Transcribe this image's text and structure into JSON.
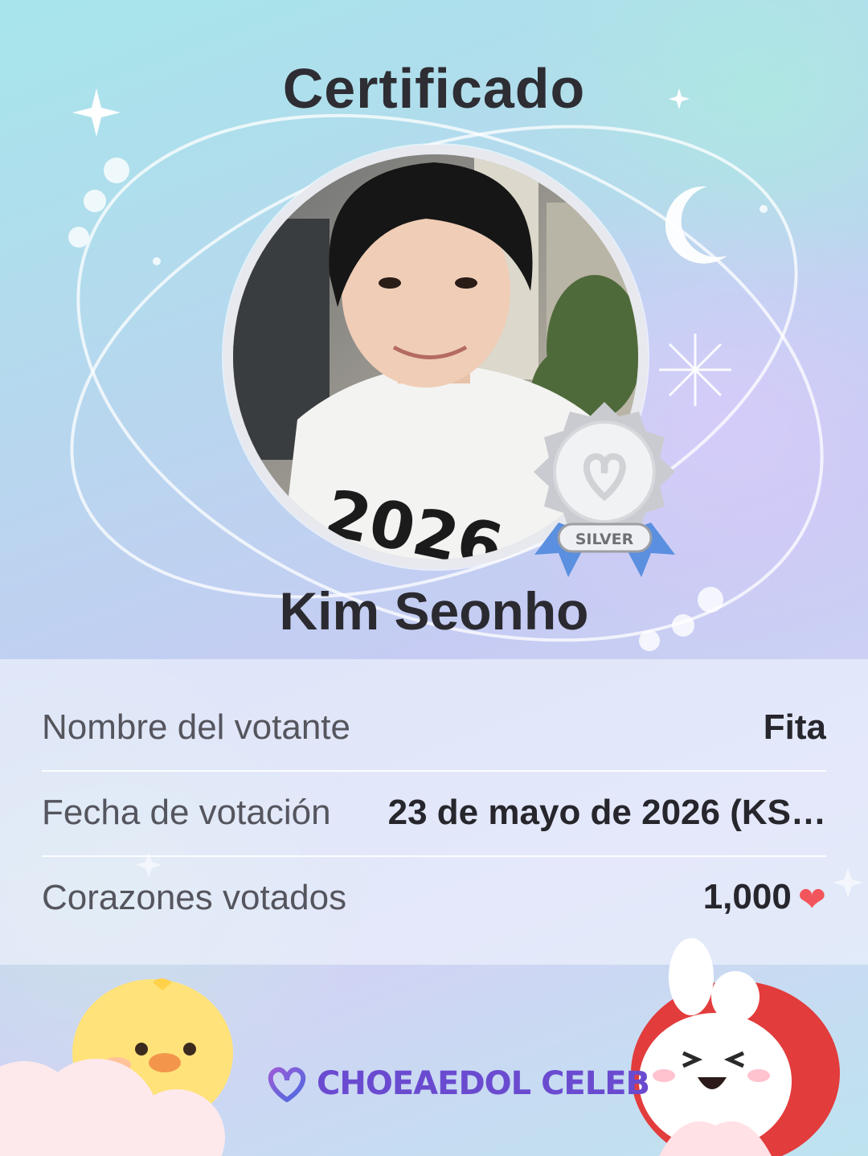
{
  "header": {
    "title": "Certificado"
  },
  "celebrity": {
    "name": "Kim Seonho"
  },
  "badge": {
    "tier": "SILVER",
    "icon": "silver-medal-icon"
  },
  "details": {
    "voter_label": "Nombre del votante",
    "voter_value": "Fita",
    "date_label": "Fecha de votación",
    "date_value": "23 de mayo de 2026 (KS…",
    "hearts_label": "Corazones votados",
    "hearts_value": "1,000",
    "hearts_icon": "heart-icon"
  },
  "brand": {
    "name": "CHOEAEDOL CELEB",
    "icon": "choeaedol-heart-logo-icon"
  },
  "colors": {
    "accent": "#6a4bd0",
    "heart": "#f2555b",
    "medal": "#c9cbd0",
    "ribbon": "#5b8fe0"
  }
}
